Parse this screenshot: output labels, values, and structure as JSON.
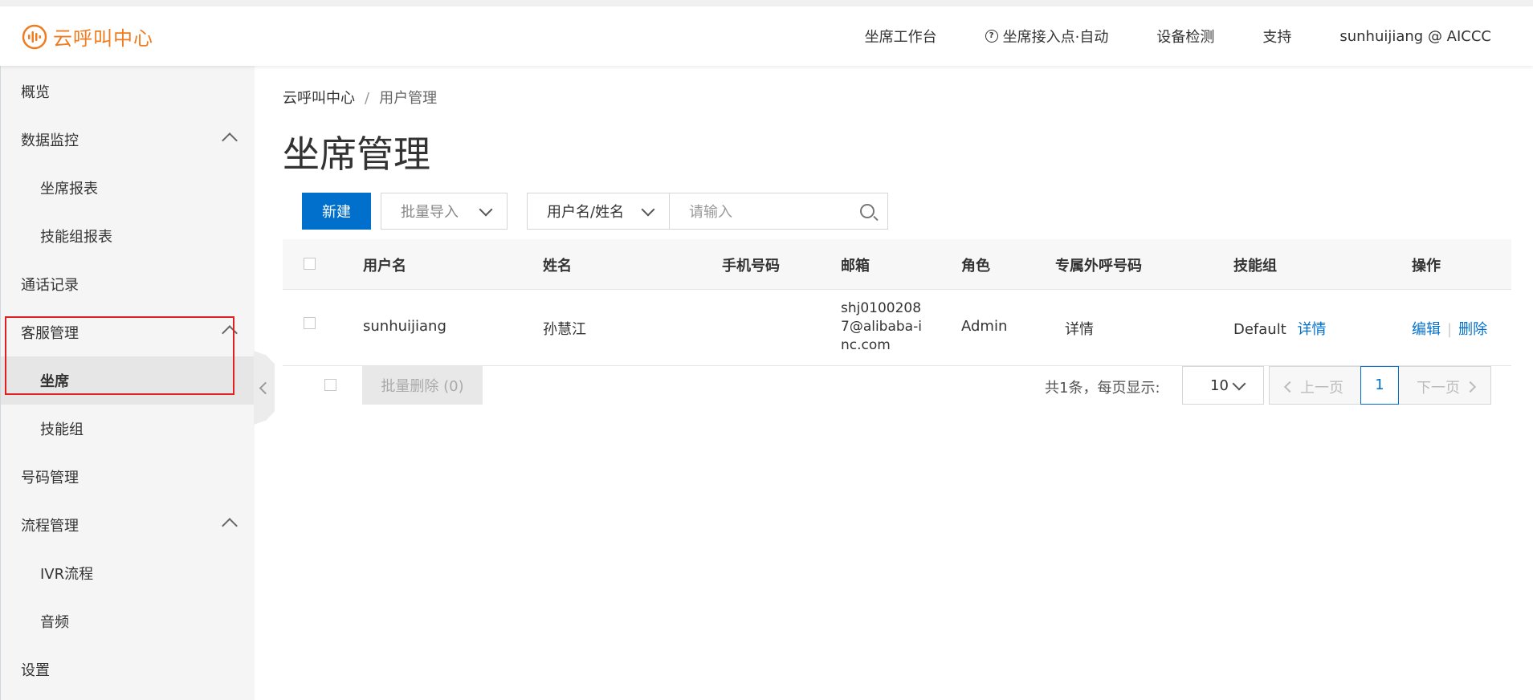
{
  "header": {
    "logo_text": "云呼叫中心",
    "nav": [
      {
        "label": "坐席工作台"
      },
      {
        "label": "坐席接入点·自动"
      },
      {
        "label": "设备检测"
      },
      {
        "label": "支持"
      },
      {
        "label": "sunhuijiang @ AICCC"
      }
    ],
    "help_glyph": "?"
  },
  "sidebar": {
    "items": [
      {
        "label": "概览"
      },
      {
        "label": "数据监控"
      },
      {
        "label": "坐席报表"
      },
      {
        "label": "技能组报表"
      },
      {
        "label": "通话记录"
      },
      {
        "label": "客服管理"
      },
      {
        "label": "坐席"
      },
      {
        "label": "技能组"
      },
      {
        "label": "号码管理"
      },
      {
        "label": "流程管理"
      },
      {
        "label": "IVR流程"
      },
      {
        "label": "音频"
      },
      {
        "label": "设置"
      }
    ],
    "active": "坐席"
  },
  "breadcrumb": {
    "root": "云呼叫中心",
    "sep": "/",
    "current": "用户管理"
  },
  "page_title": "坐席管理",
  "toolbar": {
    "new_label": "新建",
    "import_label": "批量导入",
    "field_select": "用户名/姓名",
    "search_placeholder": "请输入"
  },
  "table": {
    "headers": [
      "用户名",
      "姓名",
      "手机号码",
      "邮箱",
      "角色",
      "专属外呼号码",
      "技能组",
      "操作"
    ],
    "rows": [
      {
        "username": "sunhuijiang",
        "name": "孙慧江",
        "phone": "",
        "email": "shj01002087@alibaba-inc.com",
        "role": "Admin",
        "outbound_link": "详情",
        "skill_group": "Default",
        "skill_link": "详情",
        "edit": "编辑",
        "delete": "删除"
      }
    ]
  },
  "footer": {
    "batch_delete": "批量删除 (0)",
    "total": "共1条，每页显示:",
    "page_size": "10",
    "prev": "上一页",
    "current_page": "1",
    "next": "下一页"
  },
  "colors": {
    "primary": "#0070cc",
    "brand": "#f07c20",
    "highlight_box": "#e02020"
  }
}
